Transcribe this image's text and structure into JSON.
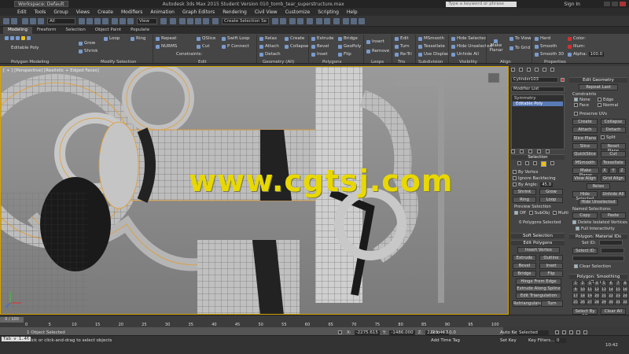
{
  "titlebar": {
    "workspace": "Workspace: Default",
    "title": "Autodesk 3ds Max 2015  Student Version   010_tomb_tear_superstructure.max",
    "search_placeholder": "Type a keyword or phrase",
    "signin": "Sign In"
  },
  "menubar": {
    "items": [
      "Edit",
      "Tools",
      "Group",
      "Views",
      "Create",
      "Modifiers",
      "Animation",
      "Graph Editors",
      "Rendering",
      "Civil View",
      "Customize",
      "Scripting",
      "Help"
    ]
  },
  "maintool": {
    "selection_filter": "All",
    "view": "View",
    "named_sel": "Create Selection Se"
  },
  "ribbon_tabs": {
    "modeling": "Modeling",
    "freeform": "Freeform",
    "selection": "Selection",
    "object_paint": "Object Paint",
    "populate": "Populate"
  },
  "ribbon": {
    "editable_poly": "Editable Poly",
    "grow": "Grow",
    "shrink": "Shrink",
    "loop": "Loop",
    "ring": "Ring",
    "repeat": "Repeat",
    "qslice": "QSlice",
    "swift_loop": "Swift Loop",
    "nurms": "NURMS",
    "cut": "Cut",
    "p_connect": "P Connect",
    "constraints": "Constraints:",
    "relax": "Relax",
    "create": "Create",
    "attach": "Attach",
    "collapse": "Collapse",
    "detach": "Detach",
    "extrude": "Extrude",
    "bridge": "Bridge",
    "bevel": "Bevel",
    "geopoly": "GeoPoly",
    "inset": "Inset",
    "flip": "Flip",
    "insert": "Insert",
    "remove": "Remove",
    "edit": "Edit",
    "turn": "Turn",
    "re_tri": "Re-Tri",
    "msmooth": "MSmooth",
    "tessellate": "Tessellate",
    "use_displac": "Use Displac",
    "hide_selected": "Hide Selected",
    "hide_unselected": "Hide Unselected",
    "unhide_all": "Unhide All",
    "make_planar": "Make Planar",
    "to_view": "To View",
    "to_grid": "To Grid",
    "hard": "Hard",
    "smooth": "Smooth",
    "smooth30": "Smooth 30",
    "color": "Color:",
    "illum": "Illum:",
    "alpha": "Alpha:",
    "alpha_value": "100.0",
    "groups": {
      "polygon_modeling": "Polygon Modeling",
      "modify_selection": "Modify Selection",
      "edit": "Edit",
      "geometry_all": "Geometry (All)",
      "polygons": "Polygons",
      "loops": "Loops",
      "tris": "Tris",
      "subdivision": "Subdivision",
      "visibility": "Visibility",
      "align": "Align",
      "properties": "Properties"
    }
  },
  "viewport": {
    "label": "[ + ] [Perspective] [Realistic + Edged Faces]",
    "watermark": "www.cgtsj.com"
  },
  "cmdpanel": {
    "object_name": "Cylinder103",
    "modifier_list": "Modifier List",
    "stack": [
      "Symmetry",
      "Editable Poly"
    ],
    "selection_head": "Selection",
    "by_vertex": "By Vertex",
    "ignore_backfacing": "Ignore Backfacing",
    "by_angle": "By Angle:",
    "by_angle_value": "45.0",
    "shrink": "Shrink",
    "grow": "Grow",
    "ring": "Ring",
    "loop": "Loop",
    "preview_selection": "Preview Selection",
    "off": "Off",
    "subobj": "SubObj",
    "multi": "Multi",
    "sel_count": "0 Polygons Selected",
    "soft_selection": "Soft Selection",
    "edit_polygons": "Edit Polygons",
    "insert_vertex": "Insert Vertex",
    "extrude": "Extrude",
    "outline": "Outline",
    "bevel": "Bevel",
    "inset": "Inset",
    "bridge": "Bridge",
    "flip": "Flip",
    "hinge_from_edge": "Hinge From Edge",
    "extrude_along_spline": "Extrude Along Spline",
    "edit_triangulation": "Edit Triangulation",
    "retriangulate": "Retriangulate",
    "turn": "Turn",
    "edit_geometry": "Edit Geometry",
    "repeat_last": "Repeat Last",
    "constraints": "Constraints",
    "none": "None",
    "edge": "Edge",
    "face": "Face",
    "normal": "Normal",
    "preserve_uvs": "Preserve UVs",
    "create": "Create",
    "collapse": "Collapse",
    "attach": "Attach",
    "detach": "Detach",
    "slice_plane": "Slice Plane",
    "split": "Split",
    "slice": "Slice",
    "reset_plane": "Reset Plane",
    "quickslice": "QuickSlice",
    "cut": "Cut",
    "msmooth": "MSmooth",
    "tessellate": "Tessellate",
    "make_planar": "Make Planar",
    "x": "X",
    "y": "Y",
    "z": "Z",
    "view_align": "View Align",
    "grid_align": "Grid Align",
    "relax": "Relax",
    "hide_selected": "Hide Selected",
    "unhide_all": "Unhide All",
    "hide_unselected": "Hide Unselected",
    "named_selections": "Named Selections:",
    "copy": "Copy",
    "paste": "Paste",
    "delete_isolated": "Delete Isolated Vertices",
    "full_interactivity": "Full Interactivity",
    "material_ids": "Polygon: Material IDs",
    "set_id": "Set ID:",
    "select_id": "Select ID",
    "clear_selection": "Clear Selection",
    "smoothing_groups": "Polygon: Smoothing Groups",
    "sg_numbers": [
      "1",
      "2",
      "3",
      "4",
      "5",
      "6",
      "7",
      "8",
      "9",
      "10",
      "11",
      "12",
      "13",
      "14",
      "15",
      "16",
      "17",
      "18",
      "19",
      "20",
      "21",
      "22",
      "23",
      "24",
      "25",
      "26",
      "27",
      "28",
      "29",
      "30",
      "31",
      "32"
    ],
    "select_by_sg": "Select By SG",
    "clear_all": "Clear All",
    "auto_smooth": "Auto Smooth",
    "auto_smooth_value": "45.0"
  },
  "timeline": {
    "frame_label": "0 / 100",
    "ticks": [
      "0",
      "5",
      "10",
      "15",
      "20",
      "25",
      "30",
      "35",
      "40",
      "45",
      "50",
      "55",
      "60",
      "65",
      "70",
      "75",
      "80",
      "85",
      "90",
      "95",
      "100"
    ]
  },
  "statusbar": {
    "script": "Tab v 1.46",
    "selected": "1 Object Selected",
    "prompt": "Click or click-and-drag to select objects",
    "x": "-2275.615",
    "y": "-1486.000",
    "z": "2263.437",
    "grid": "Grid = 10.0",
    "add_time_tag": "Add Time Tag",
    "auto_key": "Auto Key",
    "auto_key_value": "Selected",
    "set_key": "Set Key",
    "key_filters": "Key Filters...",
    "frame": "0",
    "clock": "10:42"
  }
}
